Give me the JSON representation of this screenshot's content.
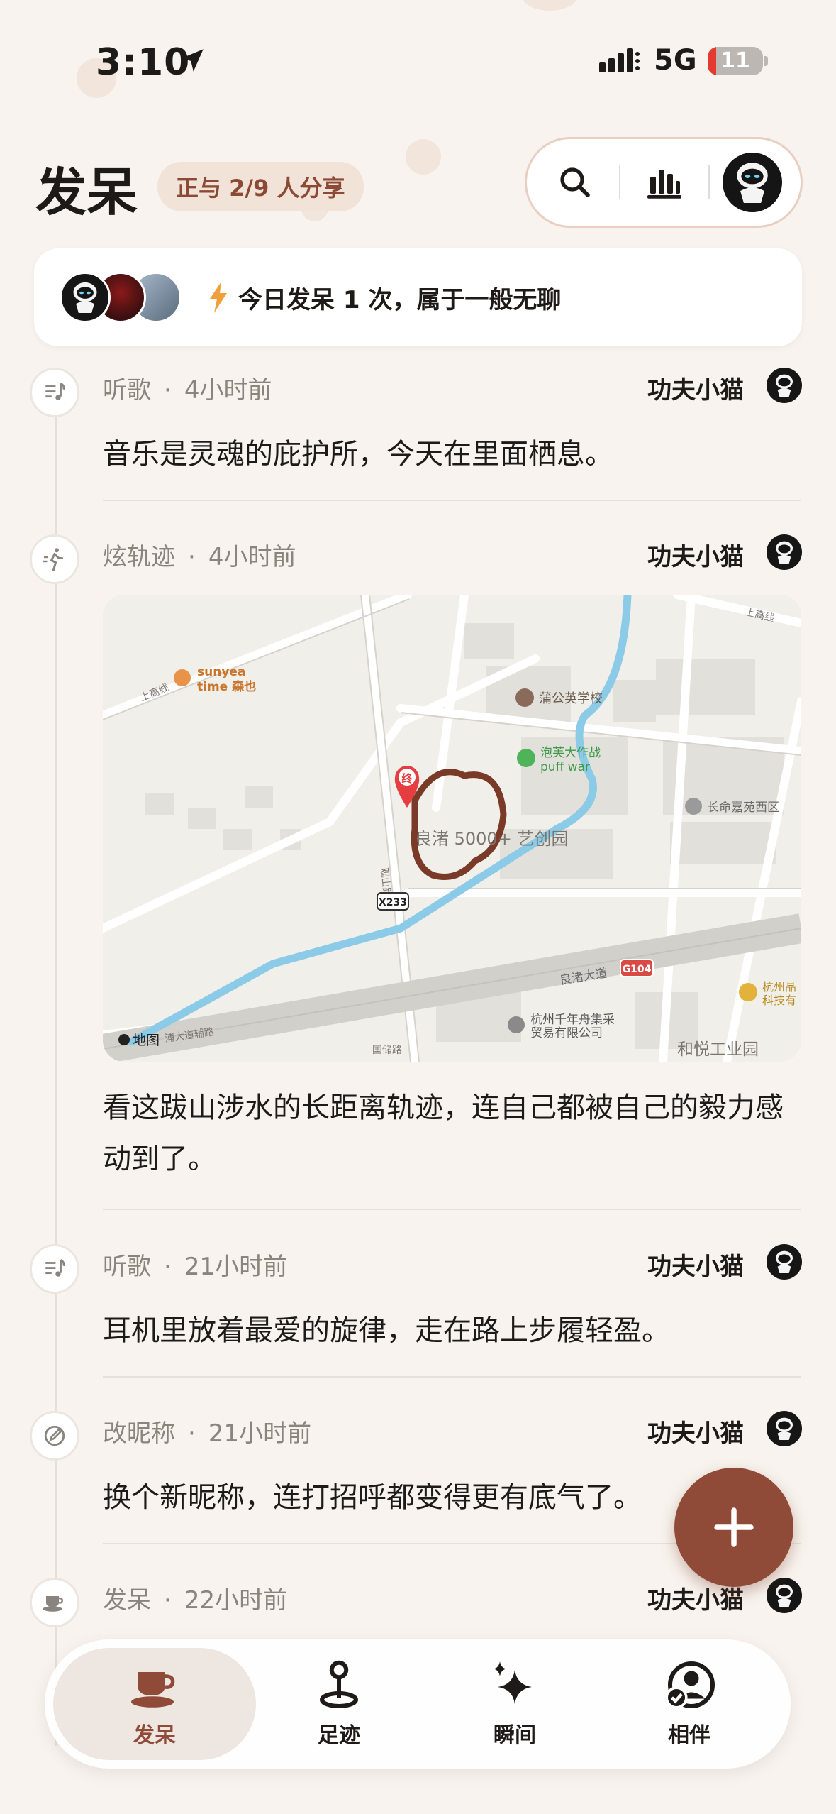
{
  "status_bar": {
    "time": "3:10",
    "network": "5G",
    "battery": "11"
  },
  "header": {
    "title": "发呆",
    "share_badge": "正与 2/9 人分享"
  },
  "summary": {
    "text": "今日发呆 1 次，属于一般无聊"
  },
  "feed": [
    {
      "type": "听歌",
      "time": "4小时前",
      "author": "功夫小猫",
      "content": "音乐是灵魂的庇护所，今天在里面栖息。"
    },
    {
      "type": "炫轨迹",
      "time": "4小时前",
      "author": "功夫小猫",
      "content": "看这跋山涉水的长距离轨迹，连自己都被自己的毅力感动到了。"
    },
    {
      "type": "听歌",
      "time": "21小时前",
      "author": "功夫小猫",
      "content": "耳机里放着最爱的旋律，走在路上步履轻盈。"
    },
    {
      "type": "改昵称",
      "time": "21小时前",
      "author": "功夫小猫",
      "content": "换个新昵称，连打招呼都变得更有底气了。"
    },
    {
      "type": "发呆",
      "time": "22小时前",
      "author": "功夫小猫",
      "content": ""
    }
  ],
  "map": {
    "labels": {
      "sunyea": "sunyea",
      "sunyea2": "time 森也",
      "school": "蒲公英学校",
      "pufwar": "泡芙大作战",
      "pufwar2": "puff war",
      "jiayuan": "长命嘉苑西区",
      "park": "良渚 5000+ 艺创园",
      "road1": "良渚大道",
      "road2": "上高线",
      "road3": "上高线",
      "road4": "浦大道辅路",
      "road5": "国储路",
      "road6": "观山路",
      "x233": "X233",
      "g104": "G104",
      "company": "杭州千年舟集采",
      "company2": "贸易有限公司",
      "industrial": "和悦工业园",
      "jingke": "杭州晶",
      "jingke2": "科技有",
      "endpoint": "终",
      "apple_maps": "地图"
    }
  },
  "tabs": [
    {
      "label": "发呆"
    },
    {
      "label": "足迹"
    },
    {
      "label": "瞬间"
    },
    {
      "label": "相伴"
    }
  ],
  "colors": {
    "accent": "#8f4b38",
    "track": "#7a3a28",
    "water": "#8ccbe8"
  }
}
